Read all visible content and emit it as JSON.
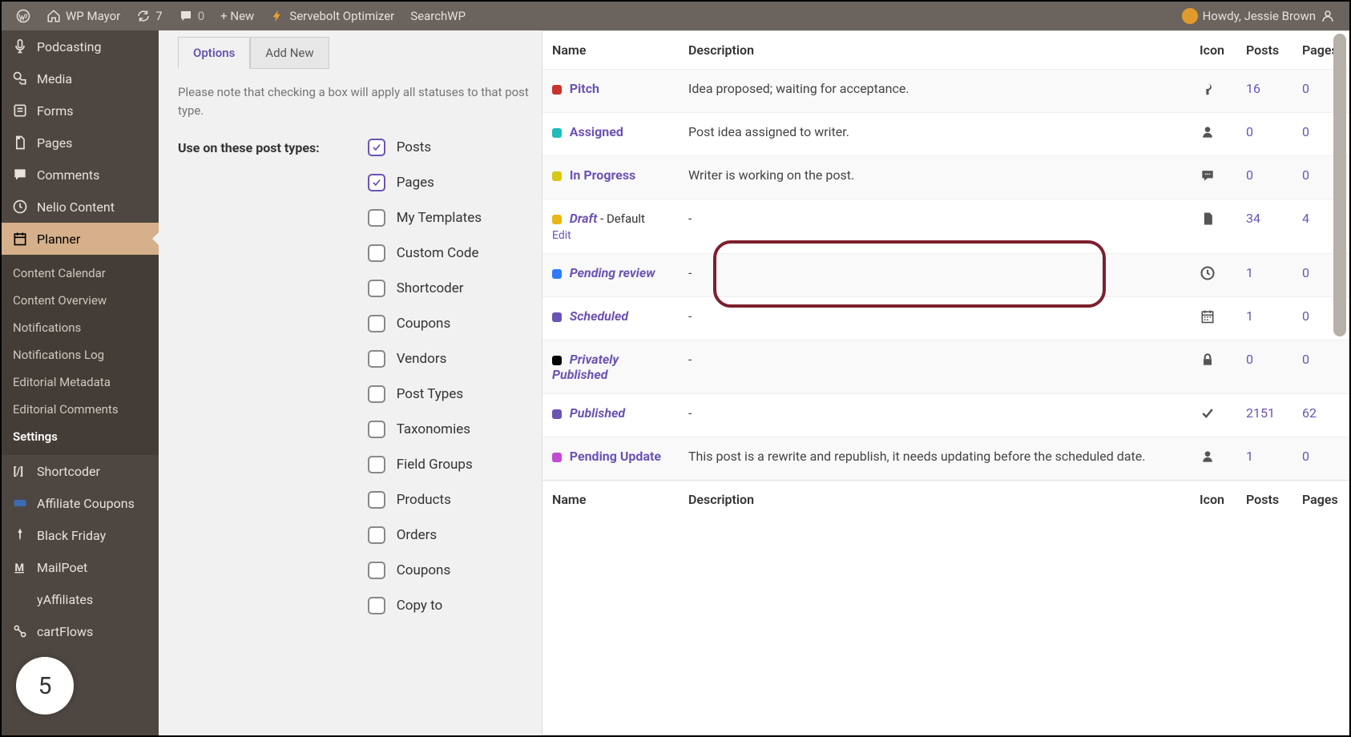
{
  "adminbar": {
    "site_name": "WP Mayor",
    "updates": "7",
    "comments": "0",
    "new": "+  New",
    "servebolt": "Servebolt Optimizer",
    "searchwp": "SearchWP",
    "howdy": "Howdy, Jessie Brown"
  },
  "sidebar": {
    "items": [
      {
        "id": "podcasting",
        "label": "Podcasting",
        "icon": "mic"
      },
      {
        "id": "media",
        "label": "Media",
        "icon": "media"
      },
      {
        "id": "forms",
        "label": "Forms",
        "icon": "forms"
      },
      {
        "id": "pages",
        "label": "Pages",
        "icon": "pages"
      },
      {
        "id": "comments",
        "label": "Comments",
        "icon": "comment"
      },
      {
        "id": "nelio",
        "label": "Nelio Content",
        "icon": "clock"
      },
      {
        "id": "planner",
        "label": "Planner",
        "icon": "calendar"
      },
      {
        "id": "shortcoder",
        "label": "Shortcoder",
        "icon": "code"
      },
      {
        "id": "affiliate",
        "label": "Affiliate Coupons",
        "icon": "coupon"
      },
      {
        "id": "blackfriday",
        "label": "Black Friday",
        "icon": "pin"
      },
      {
        "id": "mailpoet",
        "label": "MailPoet",
        "icon": "M"
      },
      {
        "id": "easyaff",
        "label": "yAffiliates",
        "icon": "star"
      },
      {
        "id": "cartflows",
        "label": "cartFlows",
        "icon": "flow"
      }
    ],
    "submenu": [
      "Content Calendar",
      "Content Overview",
      "Notifications",
      "Notifications Log",
      "Editorial Metadata",
      "Editorial Comments",
      "Settings"
    ],
    "submenu_current": "Settings"
  },
  "tabs": {
    "options": "Options",
    "addnew": "Add New"
  },
  "note": "Please note that checking a box will apply all statuses to that post type.",
  "field_label": "Use on these post types:",
  "post_types": [
    {
      "label": "Posts",
      "checked": true
    },
    {
      "label": "Pages",
      "checked": true
    },
    {
      "label": "My Templates",
      "checked": false
    },
    {
      "label": "Custom Code",
      "checked": false
    },
    {
      "label": "Shortcoder",
      "checked": false
    },
    {
      "label": "Coupons",
      "checked": false
    },
    {
      "label": "Vendors",
      "checked": false
    },
    {
      "label": "Post Types",
      "checked": false
    },
    {
      "label": "Taxonomies",
      "checked": false
    },
    {
      "label": "Field Groups",
      "checked": false
    },
    {
      "label": "Products",
      "checked": false
    },
    {
      "label": "Orders",
      "checked": false
    },
    {
      "label": "Coupons",
      "checked": false
    },
    {
      "label": "Copy to",
      "checked": false
    }
  ],
  "table": {
    "headers": {
      "name": "Name",
      "desc": "Description",
      "icon": "Icon",
      "posts": "Posts",
      "pages": "Pages"
    },
    "rows": [
      {
        "name": "Pitch",
        "italic": false,
        "suffix": "",
        "color": "#c8342b",
        "desc": "Idea proposed; waiting for acceptance.",
        "icon": "key",
        "posts": "16",
        "pages": "0"
      },
      {
        "name": "Assigned",
        "italic": false,
        "suffix": "",
        "color": "#1fbdbc",
        "desc": "Post idea assigned to writer.",
        "icon": "user",
        "posts": "0",
        "pages": "0"
      },
      {
        "name": "In Progress",
        "italic": false,
        "suffix": "",
        "color": "#d7c815",
        "desc": "Writer is working on the post.",
        "icon": "chat",
        "posts": "0",
        "pages": "0"
      },
      {
        "name": "Draft",
        "italic": true,
        "suffix": " - Default",
        "color": "#e6b817",
        "desc": "-",
        "icon": "file",
        "posts": "34",
        "pages": "4",
        "action": "Edit"
      },
      {
        "name": "Pending review",
        "italic": true,
        "suffix": "",
        "color": "#2f7bff",
        "desc": "-",
        "icon": "clock",
        "posts": "1",
        "pages": "0"
      },
      {
        "name": "Scheduled",
        "italic": true,
        "suffix": "",
        "color": "#6b54b3",
        "desc": "-",
        "icon": "calendar",
        "posts": "1",
        "pages": "0"
      },
      {
        "name": "Privately Published",
        "italic": true,
        "suffix": "",
        "color": "#000",
        "desc": "-",
        "icon": "lock",
        "posts": "0",
        "pages": "0"
      },
      {
        "name": "Published",
        "italic": true,
        "suffix": "",
        "color": "#6b54b3",
        "desc": "-",
        "icon": "check",
        "posts": "2151",
        "pages": "62"
      },
      {
        "name": "Pending Update",
        "italic": false,
        "suffix": "",
        "color": "#c24bd1",
        "desc": "This post is a rewrite and republish, it needs updating before the scheduled date.",
        "icon": "user",
        "posts": "1",
        "pages": "0"
      }
    ]
  },
  "page_badge": "5"
}
